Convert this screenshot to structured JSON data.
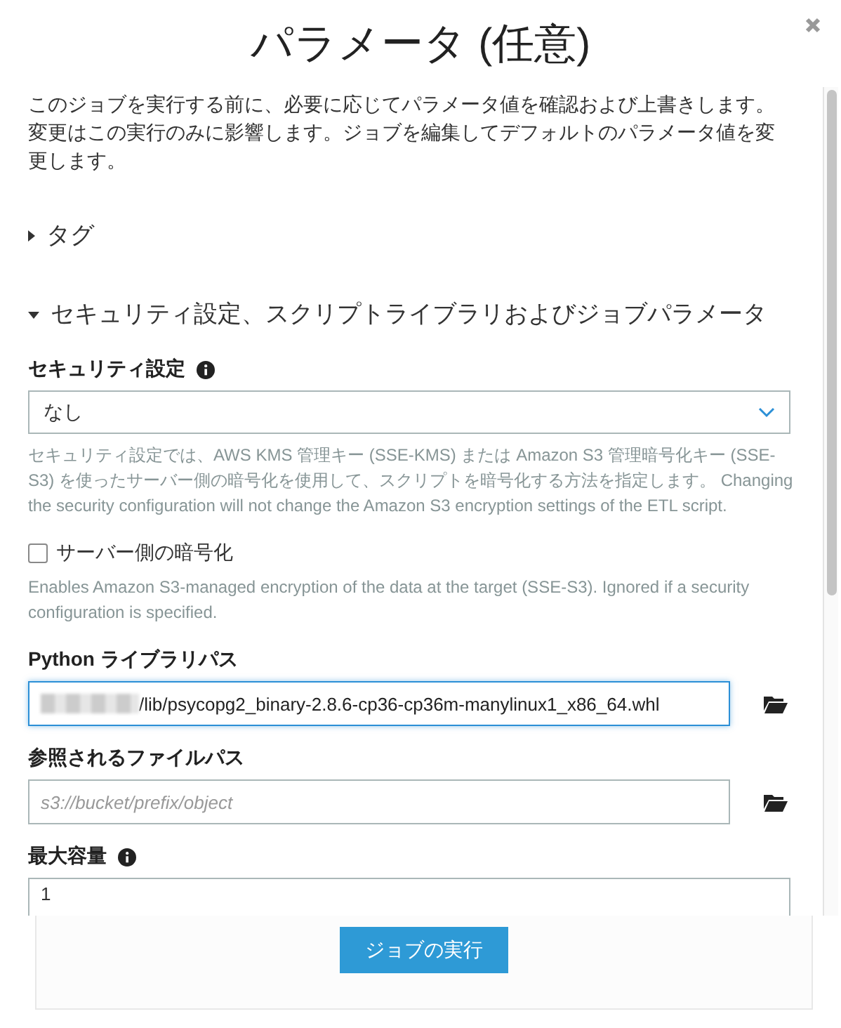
{
  "dialog": {
    "title": "パラメータ (任意)"
  },
  "description": "このジョブを実行する前に、必要に応じてパラメータ値を確認および上書きします。変更はこの実行のみに影響します。ジョブを編集してデフォルトのパラメータ値を変更します。",
  "sections": [
    {
      "title": "タグ",
      "expanded": false
    },
    {
      "title": "セキュリティ設定、スクリプトライブラリおよびジョブパラメータ",
      "expanded": true
    }
  ],
  "fields": [
    {
      "kind": "select",
      "label": "セキュリティ設定",
      "info": true,
      "value": "なし",
      "help": "セキュリティ設定では、AWS KMS 管理キー (SSE-KMS) または Amazon S3 管理暗号化キー (SSE-S3) を使ったサーバー側の暗号化を使用して、スクリプトを暗号化する方法を指定します。 Changing the security configuration will not change the Amazon S3 encryption settings of the ETL script."
    },
    {
      "kind": "checkbox",
      "label": "サーバー側の暗号化",
      "checked": false,
      "help": "Enables Amazon S3-managed encryption of the data at the target (SSE-S3). Ignored if a security configuration is specified."
    },
    {
      "kind": "path",
      "label": "Python ライブラリパス",
      "value": "/lib/psycopg2_binary-2.8.6-cp36-cp36m-manylinux1_x86_64.whl",
      "redacted": true,
      "focused": true
    },
    {
      "kind": "path",
      "label": "参照されるファイルパス",
      "placeholder": "s3://bucket/prefix/object",
      "redacted": false,
      "focused": false
    },
    {
      "kind": "text",
      "label": "最大容量",
      "info": true,
      "value": "1"
    }
  ],
  "run_button": "ジョブの実行"
}
